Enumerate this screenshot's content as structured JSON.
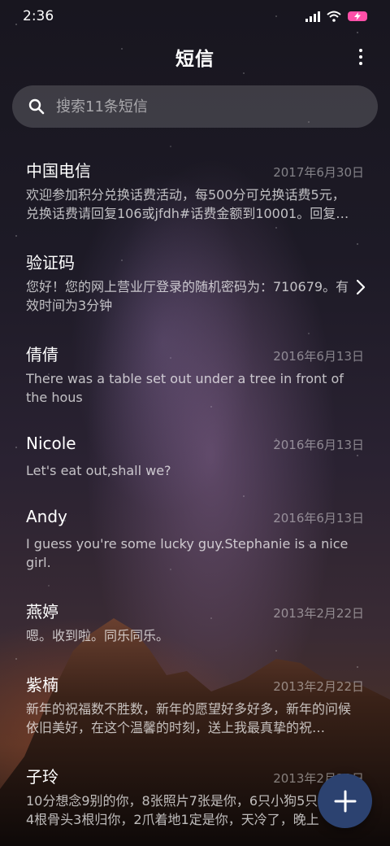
{
  "status_bar": {
    "time": "2:36",
    "battery_color": "#ff4fa8"
  },
  "header": {
    "title": "短信",
    "more_icon": "more-vertical-icon"
  },
  "search": {
    "placeholder": "搜索11条短信",
    "value": ""
  },
  "messages": [
    {
      "sender": "中国电信",
      "date": "2017年6月30日",
      "preview": "欢迎参加积分兑换话费活动，每500分可兑换话费5元，兑换话费请回复106或jfdh#话费金额到10001。回复…"
    },
    {
      "sender": "验证码",
      "date": "",
      "preview": "您好！您的网上营业厅登录的随机密码为：710679。有效时间为3分钟"
    },
    {
      "sender": "倩倩",
      "date": "2016年6月13日",
      "preview": "There was a table set out under a tree in front of the hous"
    },
    {
      "sender": "Nicole",
      "date": "2016年6月13日",
      "preview": "Let's eat out,shall we?"
    },
    {
      "sender": "Andy",
      "date": "2016年6月13日",
      "preview": "I guess you're some lucky guy.Stephanie is a nice girl."
    },
    {
      "sender": "燕婷",
      "date": "2013年2月22日",
      "preview": "嗯。收到啦。同乐同乐。"
    },
    {
      "sender": "紫楠",
      "date": "2013年2月22日",
      "preview": "新年的祝福数不胜数，新年的愿望好多好多，新年的问候依旧美好，在这个温馨的时刻，送上我最真挚的祝…"
    },
    {
      "sender": "子玲",
      "date": "2013年2月22日",
      "preview": "10分想念9别的你，8张照片7张是你，6只小狗5只像你，4根骨头3根归你，2爪着地1定是你，天冷了，晚上"
    }
  ],
  "fab": {
    "icon": "plus-icon",
    "color": "#2c4270"
  }
}
